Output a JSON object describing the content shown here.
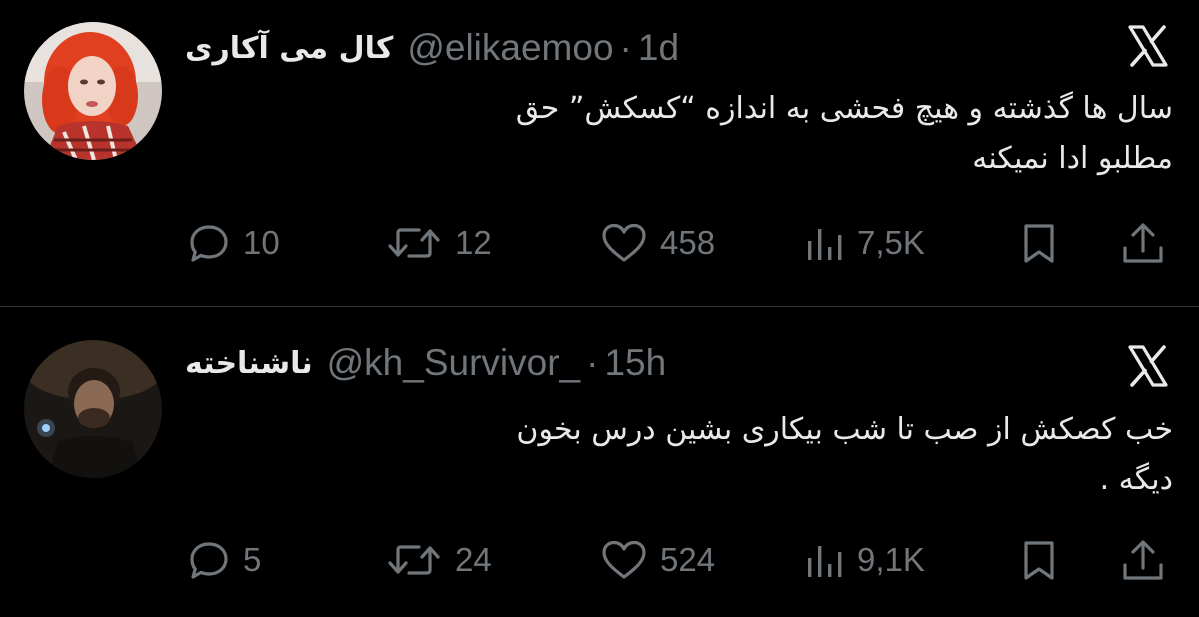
{
  "colors": {
    "background": "#000000",
    "text_primary": "#e7e9ea",
    "text_secondary": "#71767b",
    "divider": "#2f3336"
  },
  "tweets": [
    {
      "display_name": "کال می آکاری",
      "handle": "@elikaemoo",
      "separator": "·",
      "time": "1d",
      "text_lines": [
        "سال ها گذشته و هیچ فحشی به اندازه “کسکش” حق",
        "مطلبو ادا نمیکنه"
      ],
      "replies": "10",
      "retweets": "12",
      "likes": "458",
      "views": "7,5K",
      "avatar_icon": "avatar-red-hair",
      "logo_icon": "x-logo-icon"
    },
    {
      "display_name": "ناشناخته",
      "handle": "@kh_Survivor_",
      "separator": "·",
      "time": "15h",
      "text_lines": [
        "خب کصکش از صب تا شب بیکاری بشین درس بخون",
        "دیگه ."
      ],
      "replies": "5",
      "retweets": "24",
      "likes": "524",
      "views": "9,1K",
      "avatar_icon": "avatar-dark-photo",
      "logo_icon": "x-logo-icon"
    }
  ]
}
